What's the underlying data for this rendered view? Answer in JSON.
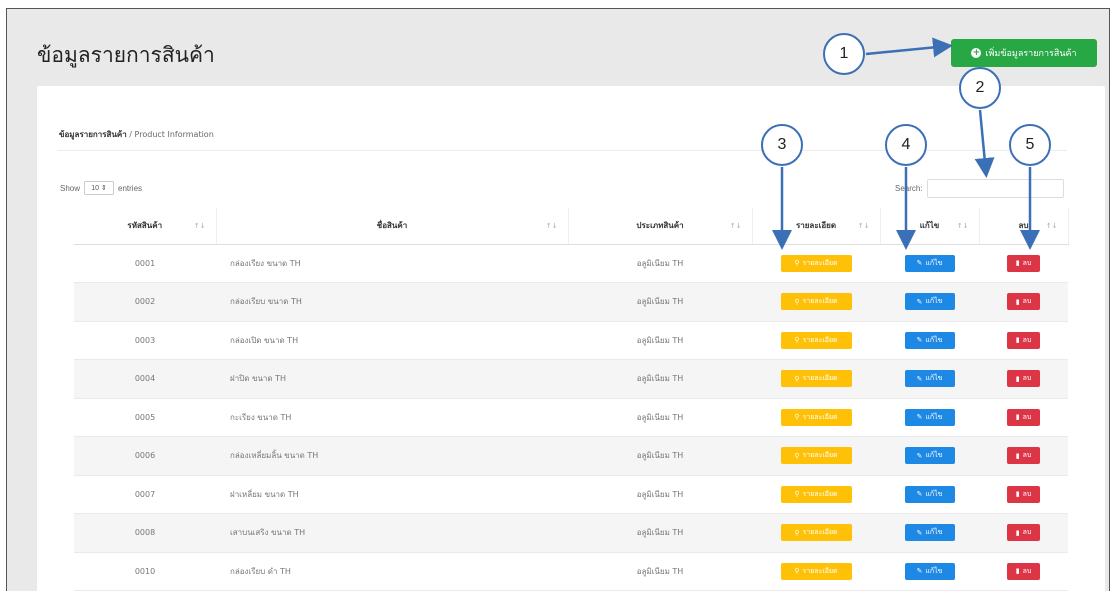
{
  "page": {
    "title": "ข้อมูลรายการสินค้า",
    "add_button_label": "เพิ่มข้อมูลรายการสินค้า",
    "add_button_icon": "plus-circle-icon"
  },
  "breadcrumb": {
    "bold": "ข้อมูลรายการสินค้า",
    "rest": " / Product Information"
  },
  "controls": {
    "show_label": "Show",
    "entries_value": "10",
    "entries_label": "entries",
    "search_label": "Search:",
    "search_value": ""
  },
  "table": {
    "columns": [
      "รหัสสินค้า",
      "ชื่อสินค้า",
      "ประเภทสินค้า",
      "รายละเอียด",
      "แก้ไข",
      "ลบ"
    ],
    "rows": [
      {
        "code": "0001",
        "name": "กล่องเรียง ขนาด TH",
        "type": "อลูมิเนียม TH"
      },
      {
        "code": "0002",
        "name": "กล่องเรียบ ขนาด TH",
        "type": "อลูมิเนียม TH"
      },
      {
        "code": "0003",
        "name": "กล่องเปิด ขนาด TH",
        "type": "อลูมิเนียม TH"
      },
      {
        "code": "0004",
        "name": "ฝาปิด ขนาด TH",
        "type": "อลูมิเนียม TH"
      },
      {
        "code": "0005",
        "name": "กะเรียง ขนาด TH",
        "type": "อลูมิเนียม TH"
      },
      {
        "code": "0006",
        "name": "กล่องเหลี่ยมลิ้น ขนาด TH",
        "type": "อลูมิเนียม TH"
      },
      {
        "code": "0007",
        "name": "ฝาเหลี่ยม ขนาด TH",
        "type": "อลูมิเนียม TH"
      },
      {
        "code": "0008",
        "name": "เสาบนเสริง ขนาด TH",
        "type": "อลูมิเนียม TH"
      },
      {
        "code": "0010",
        "name": "กล่องเรียบ ดำ TH",
        "type": "อลูมิเนียม TH"
      }
    ],
    "detail_label": "รายละเอียด",
    "edit_label": "แก้ไข",
    "delete_label": "ลบ",
    "detail_icon": "search-icon",
    "edit_icon": "edit-icon",
    "delete_icon": "trash-icon"
  },
  "callouts": [
    "1",
    "2",
    "3",
    "4",
    "5"
  ],
  "colors": {
    "add_green": "#28a745",
    "detail_yellow": "#ffc107",
    "edit_blue": "#1e88e5",
    "delete_red": "#dc3545",
    "callout_blue": "#3b6fb6"
  }
}
